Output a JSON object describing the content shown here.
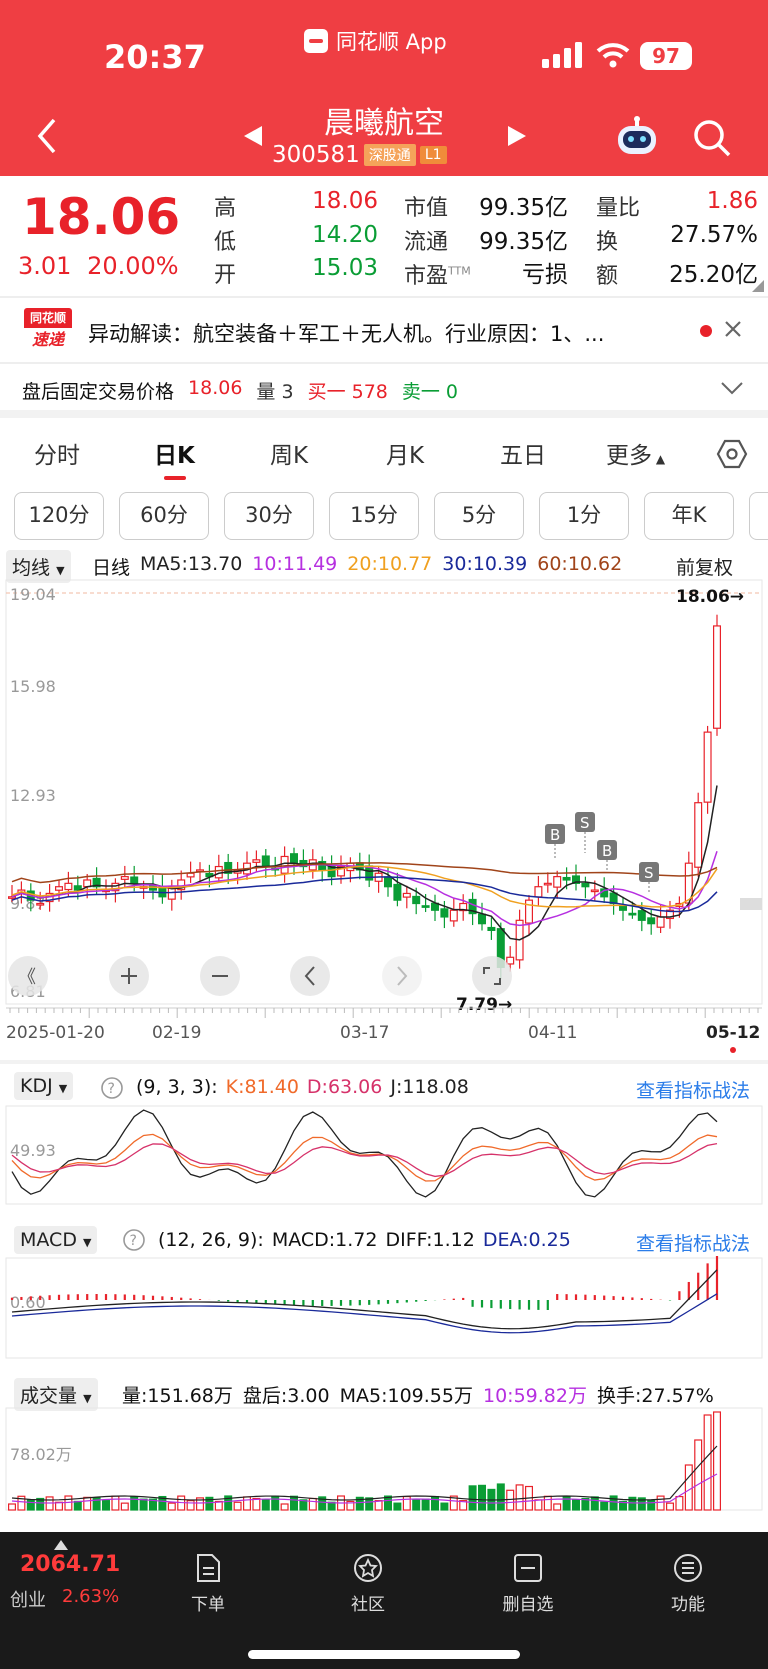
{
  "status": {
    "time": "20:37",
    "app": "同花顺 App",
    "battery": "97"
  },
  "header": {
    "title": "晨曦航空",
    "code": "300581",
    "tags": [
      "深股通",
      "L1"
    ]
  },
  "quote": {
    "price": "18.06",
    "change": "3.01",
    "change_pct": "20.00%",
    "high_label": "高",
    "high": "18.06",
    "low_label": "低",
    "low": "14.20",
    "open_label": "开",
    "open": "15.03",
    "mcap_label": "市值",
    "mcap": "99.35亿",
    "float_label": "流通",
    "float": "99.35亿",
    "pe_label": "市盈",
    "pe_sup": "TTM",
    "pe": "亏损",
    "vr_label": "量比",
    "vr": "1.86",
    "turn_label": "换",
    "turn": "27.57%",
    "amt_label": "额",
    "amt": "25.20亿"
  },
  "news": {
    "badge_top": "同花顺",
    "badge_bottom": "速递",
    "text": "异动解读：航空装备＋军工＋无人机。行业原因：1、..."
  },
  "after_hours": {
    "label": "盘后固定交易价格",
    "price": "18.06",
    "vol_label": "量 3",
    "buy": "买一 578",
    "sell": "卖一 0"
  },
  "tabs": [
    "分时",
    "日K",
    "周K",
    "月K",
    "五日",
    "更多"
  ],
  "active_tab": "日K",
  "periods": [
    "120分",
    "60分",
    "30分",
    "15分",
    "5分",
    "1分",
    "年K"
  ],
  "kline": {
    "mode": "均线",
    "period": "日线",
    "ma": {
      "ma5": "MA5:13.70",
      "ma10": "10:11.49",
      "ma20": "20:10.77",
      "ma30": "30:10.39",
      "ma60": "60:10.62"
    },
    "adjust": "前复权",
    "y_ticks": [
      "19.04",
      "15.98",
      "12.93",
      "9.87",
      "6.81"
    ],
    "high_mark": "18.06→",
    "low_mark": "7.79→",
    "dates": [
      "2025-01-20",
      "02-19",
      "03-17",
      "04-11",
      "05-12"
    ],
    "signals": [
      "B",
      "S",
      "B",
      "S"
    ]
  },
  "kdj": {
    "name": "KDJ",
    "params": "(9, 3, 3):",
    "k": "K:81.40",
    "d": "D:63.06",
    "j": "J:118.08",
    "link": "查看指标战法",
    "tick": "49.93"
  },
  "macd": {
    "name": "MACD",
    "params": "(12, 26, 9):",
    "macd": "MACD:1.72",
    "diff": "DIFF:1.12",
    "dea": "DEA:0.25",
    "link": "查看指标战法",
    "tick": "0.60"
  },
  "volume": {
    "name": "成交量",
    "vol": "量:151.68万",
    "after": "盘后:3.00",
    "ma5": "MA5:109.55万",
    "ma10": "10:59.82万",
    "turn": "换手:27.57%",
    "tick": "78.02万"
  },
  "colors": {
    "up": "#e8222a",
    "down": "#0a9d35",
    "ma5": "#222222",
    "ma10": "#b630e0",
    "ma20": "#f0a020",
    "ma30": "#1a2a9a",
    "ma60": "#a0441a",
    "header": "#ef3e43"
  },
  "bottom": {
    "index_value": "2064.71",
    "index_name": "创业",
    "index_pct": "2.63%",
    "nav": [
      "下单",
      "社区",
      "删自选",
      "功能"
    ]
  }
}
